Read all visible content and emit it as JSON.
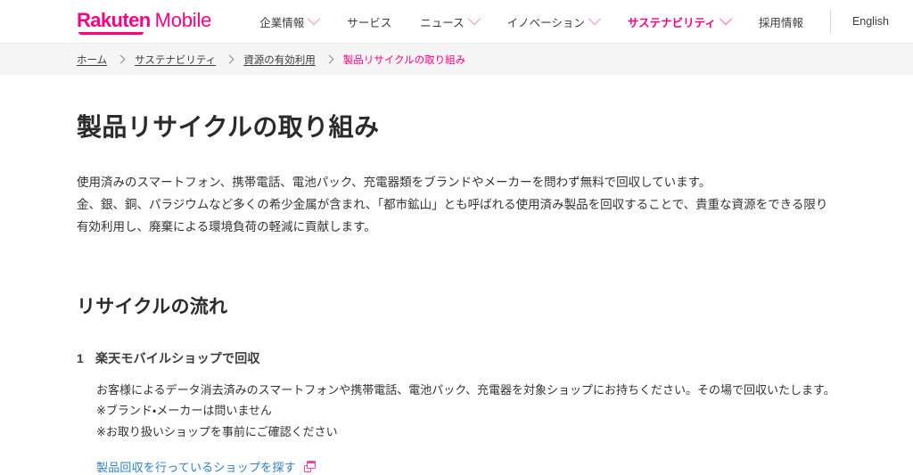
{
  "header": {
    "logo": {
      "primary": "Rakuten",
      "secondary": "Mobile"
    },
    "nav": [
      {
        "label": "企業情報",
        "has_caret": true,
        "active": false
      },
      {
        "label": "サービス",
        "has_caret": false,
        "active": false
      },
      {
        "label": "ニュース",
        "has_caret": true,
        "active": false
      },
      {
        "label": "イノベーション",
        "has_caret": true,
        "active": false
      },
      {
        "label": "サステナビリティ",
        "has_caret": true,
        "active": true
      },
      {
        "label": "採用情報",
        "has_caret": false,
        "active": false
      }
    ],
    "language_link": "English"
  },
  "breadcrumb": [
    {
      "label": "ホーム",
      "current": false
    },
    {
      "label": "サステナビリティ",
      "current": false
    },
    {
      "label": "資源の有効利用",
      "current": false
    },
    {
      "label": "製品リサイクルの取り組み",
      "current": true
    }
  ],
  "main": {
    "page_title": "製品リサイクルの取り組み",
    "intro": [
      "使用済みのスマートフォン、携帯電話、電池パック、充電器類をブランドやメーカーを問わず無料で回収しています。",
      "金、銀、銅、パラジウムなど多くの希少金属が含まれ、「都市鉱山」とも呼ばれる使用済み製品を回収することで、貴重な資源をできる限り有効利用し、廃棄による環境負荷の軽減に貢献します。"
    ],
    "section_heading": "リサイクルの流れ",
    "steps": [
      {
        "number": "1",
        "title": "楽天モバイルショップで回収",
        "body": "お客様によるデータ消去済みのスマートフォンや携帯電話、電池パック、充電器を対象ショップにお持ちください。その場で回収いたします。",
        "notes": [
          "※ブランド・メーカーは問いません",
          "※お取り扱いショップを事前にご確認ください"
        ],
        "link": "製品回収を行っているショップを探す"
      }
    ]
  },
  "colors": {
    "brand_pink": "#ff0084",
    "link_blue": "#2f7fc4",
    "text_dark": "#333333",
    "breadcrumb_bg": "#f5f5f5"
  }
}
